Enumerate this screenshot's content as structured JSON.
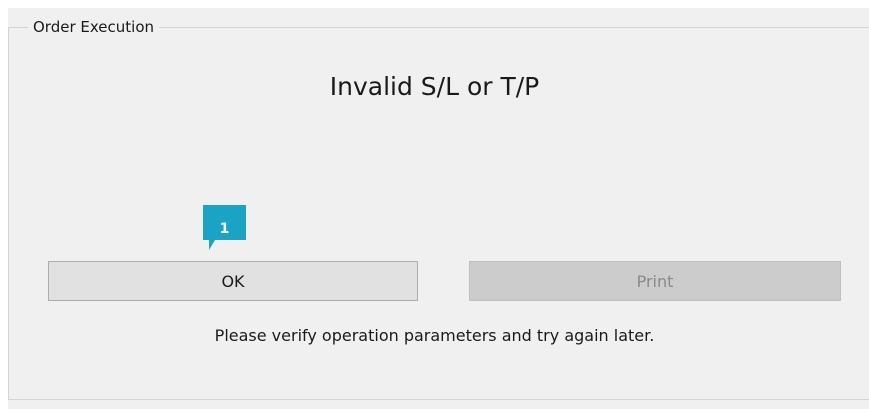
{
  "dialog": {
    "group_title": "Order Execution",
    "heading": "Invalid S/L or T/P",
    "ok_label": "OK",
    "print_label": "Print",
    "message": "Please verify operation parameters and try again later."
  },
  "annotation": {
    "step_number": "1",
    "color": "#1aa3c4"
  }
}
